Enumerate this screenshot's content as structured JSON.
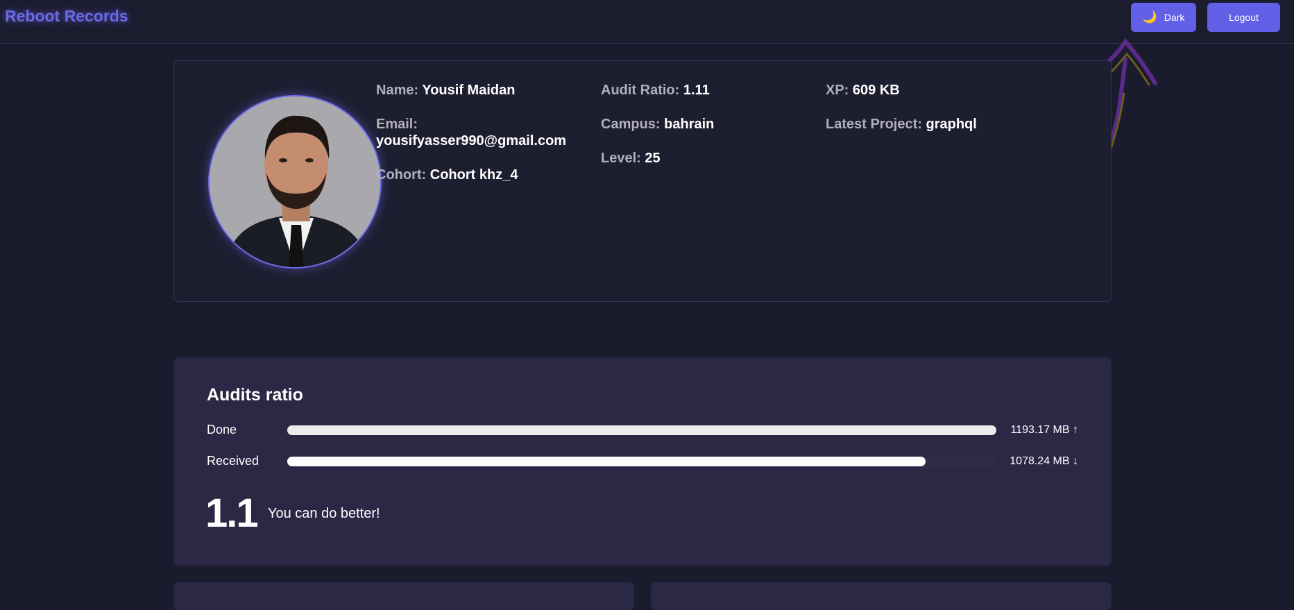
{
  "header": {
    "brand": "Reboot Records",
    "theme_button": {
      "icon": "moon-icon",
      "label": "Dark"
    },
    "logout_label": "Logout"
  },
  "profile": {
    "avatar_alt": "profile-photo",
    "name_key": "Name:",
    "name": "Yousif Maidan",
    "email_key": "Email:",
    "email": "yousifyasser990@gmail.com",
    "cohort_key": "Cohort:",
    "cohort": "Cohort khz_4",
    "audit_ratio_key": "Audit Ratio:",
    "audit_ratio": "1.11",
    "campus_key": "Campus:",
    "campus": "bahrain",
    "level_key": "Level:",
    "level": "25",
    "xp_key": "XP:",
    "xp": "609 KB",
    "latest_project_key": "Latest Project:",
    "latest_project": "graphql"
  },
  "audits": {
    "title": "Audits ratio",
    "done": {
      "label": "Done",
      "value": "1193.17 MB ↑",
      "fraction": 1.0,
      "color": "#ececec"
    },
    "received": {
      "label": "Received",
      "value": "1078.24 MB ↓",
      "fraction": 0.9,
      "color": "#ffffff"
    },
    "ratio": "1.1",
    "message": "You can do better!"
  },
  "colors": {
    "accent": "#6360e8",
    "background": "#1b1b2e",
    "card": "#2b2845"
  }
}
